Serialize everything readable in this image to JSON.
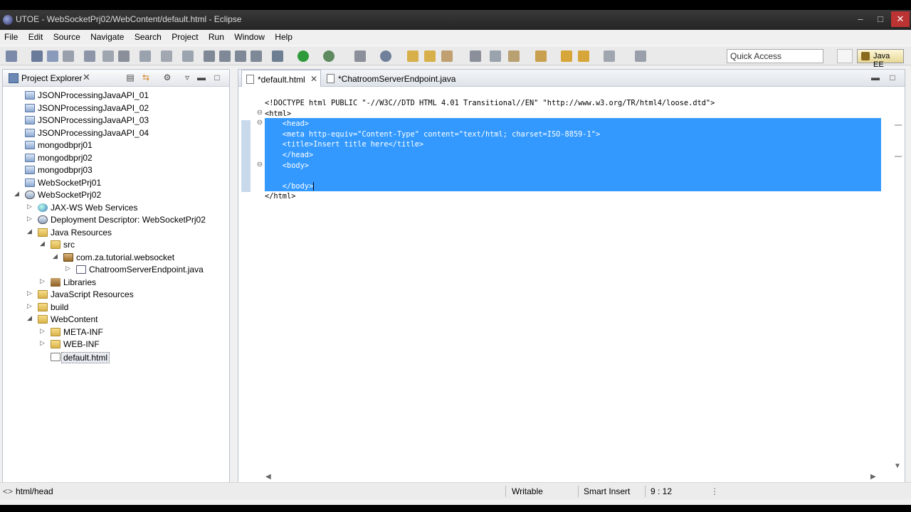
{
  "window": {
    "title": "UTOE - WebSocketPrj02/WebContent/default.html - Eclipse",
    "controls": {
      "minimize": "–",
      "maximize": "□",
      "close": "✕"
    }
  },
  "menubar": [
    "File",
    "Edit",
    "Source",
    "Navigate",
    "Search",
    "Project",
    "Run",
    "Window",
    "Help"
  ],
  "toolbar": {
    "quick_access": "Quick Access",
    "perspective": "Java EE"
  },
  "explorer": {
    "title": "Project Explorer",
    "close": "✕",
    "items": [
      {
        "label": "JSONProcessingJavaAPI_01",
        "icon": "project-icon",
        "depth": 0,
        "expander": ""
      },
      {
        "label": "JSONProcessingJavaAPI_02",
        "icon": "project-icon",
        "depth": 0,
        "expander": ""
      },
      {
        "label": "JSONProcessingJavaAPI_03",
        "icon": "project-icon",
        "depth": 0,
        "expander": ""
      },
      {
        "label": "JSONProcessingJavaAPI_04",
        "icon": "project-icon",
        "depth": 0,
        "expander": ""
      },
      {
        "label": "mongodbprj01",
        "icon": "project-icon",
        "depth": 0,
        "expander": ""
      },
      {
        "label": "mongodbprj02",
        "icon": "project-icon",
        "depth": 0,
        "expander": ""
      },
      {
        "label": "mongodbprj03",
        "icon": "project-icon",
        "depth": 0,
        "expander": ""
      },
      {
        "label": "WebSocketPrj01",
        "icon": "project-icon",
        "depth": 0,
        "expander": ""
      },
      {
        "label": "WebSocketPrj02",
        "icon": "web-project-icon",
        "depth": 0,
        "expander": "◢"
      },
      {
        "label": "JAX-WS Web Services",
        "icon": "globe-icon",
        "depth": 1,
        "expander": "▷"
      },
      {
        "label": "Deployment Descriptor: WebSocketPrj02",
        "icon": "descriptor-icon",
        "depth": 1,
        "expander": "▷"
      },
      {
        "label": "Java Resources",
        "icon": "folder-icon",
        "depth": 1,
        "expander": "◢"
      },
      {
        "label": "src",
        "icon": "folder-icon",
        "depth": 2,
        "expander": "◢"
      },
      {
        "label": "com.za.tutorial.websocket",
        "icon": "package-icon",
        "depth": 3,
        "expander": "◢"
      },
      {
        "label": "ChatroomServerEndpoint.java",
        "icon": "java-file-icon",
        "depth": 4,
        "expander": "▷"
      },
      {
        "label": "Libraries",
        "icon": "library-icon",
        "depth": 2,
        "expander": "▷"
      },
      {
        "label": "JavaScript Resources",
        "icon": "folder-icon",
        "depth": 1,
        "expander": "▷"
      },
      {
        "label": "build",
        "icon": "folder-icon",
        "depth": 1,
        "expander": "▷"
      },
      {
        "label": "WebContent",
        "icon": "folder-icon",
        "depth": 1,
        "expander": "◢"
      },
      {
        "label": "META-INF",
        "icon": "folder-icon",
        "depth": 2,
        "expander": "▷"
      },
      {
        "label": "WEB-INF",
        "icon": "folder-icon",
        "depth": 2,
        "expander": "▷"
      },
      {
        "label": "default.html",
        "icon": "html-file-icon",
        "depth": 2,
        "expander": "",
        "selected": true
      }
    ]
  },
  "editor": {
    "tabs": [
      {
        "label": "*default.html",
        "active": true,
        "close": "✕"
      },
      {
        "label": "*ChatroomServerEndpoint.java",
        "active": false
      }
    ],
    "lines": [
      {
        "text": "<!DOCTYPE html PUBLIC \"-//W3C//DTD HTML 4.01 Transitional//EN\" \"http://www.w3.org/TR/html4/loose.dtd\">",
        "selected": false,
        "fold": ""
      },
      {
        "text": "<html>",
        "selected": false,
        "fold": "⊖"
      },
      {
        "text": "    <head>",
        "selected": true,
        "fold": "⊖"
      },
      {
        "text": "    <meta http-equiv=\"Content-Type\" content=\"text/html; charset=ISO-8859-1\">",
        "selected": true,
        "fold": ""
      },
      {
        "text": "    <title>Insert title here</title>",
        "selected": true,
        "fold": ""
      },
      {
        "text": "    </head>",
        "selected": true,
        "fold": ""
      },
      {
        "text": "    <body>",
        "selected": true,
        "fold": "⊖"
      },
      {
        "text": "",
        "selected": true,
        "fold": ""
      },
      {
        "text": "    </body>",
        "selected": true,
        "fold": ""
      },
      {
        "text": "</html>",
        "selected": false,
        "fold": ""
      }
    ]
  },
  "status": {
    "path": "html/head",
    "writable": "Writable",
    "insert_mode": "Smart Insert",
    "position": "9 : 12"
  }
}
